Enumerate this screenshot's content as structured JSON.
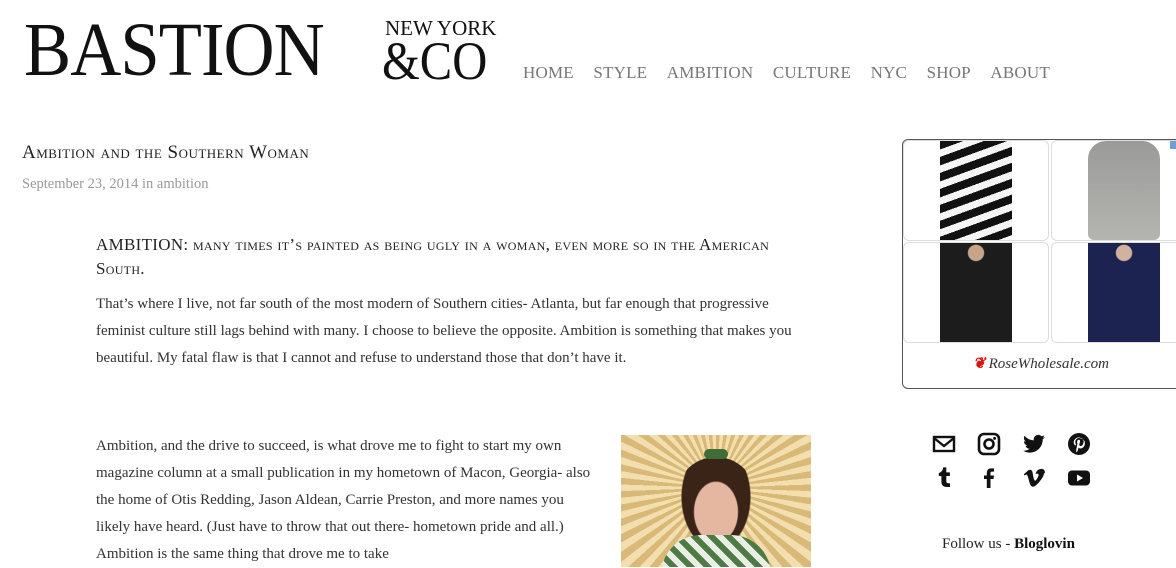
{
  "header": {
    "logo_main": "BASTION",
    "logo_ny": "NEW YORK",
    "logo_co": "&CO",
    "nav": [
      "HOME",
      "STYLE",
      "AMBITION",
      "CULTURE",
      "NYC",
      "SHOP",
      "ABOUT"
    ]
  },
  "post": {
    "title": "Ambition and the Southern Woman",
    "date": "September 23, 2014",
    "meta_in": "in",
    "category": "ambition",
    "lead": "AMBITION: many times it’s painted as being ugly in a woman, even more so in the American South.",
    "paragraph1": "That’s where I live, not far south of the most modern of Southern cities- Atlanta, but far enough that progressive feminist culture still lags behind with many. I choose to believe the opposite. Ambition is something that makes you beautiful. My fatal flaw is that I cannot and refuse to understand those that don’t have it.",
    "paragraph2": "Ambition, and the drive to succeed, is what drove me to fight to start my own magazine column at a small publication in my hometown of Macon, Georgia- also the home of Otis Redding, Jason Aldean, Carrie Preston, and more names you likely have heard. (Just have to throw that out there- hometown pride and all.) Ambition is the same thing that drove me to take"
  },
  "sidebar": {
    "ad_brand": "RoseWholesale.com",
    "follow_label": "Follow us - ",
    "follow_link": "Bloglovin",
    "icons": [
      "email-icon",
      "instagram-icon",
      "twitter-icon",
      "pinterest-icon",
      "tumblr-icon",
      "facebook-icon",
      "vimeo-icon",
      "youtube-icon"
    ]
  }
}
